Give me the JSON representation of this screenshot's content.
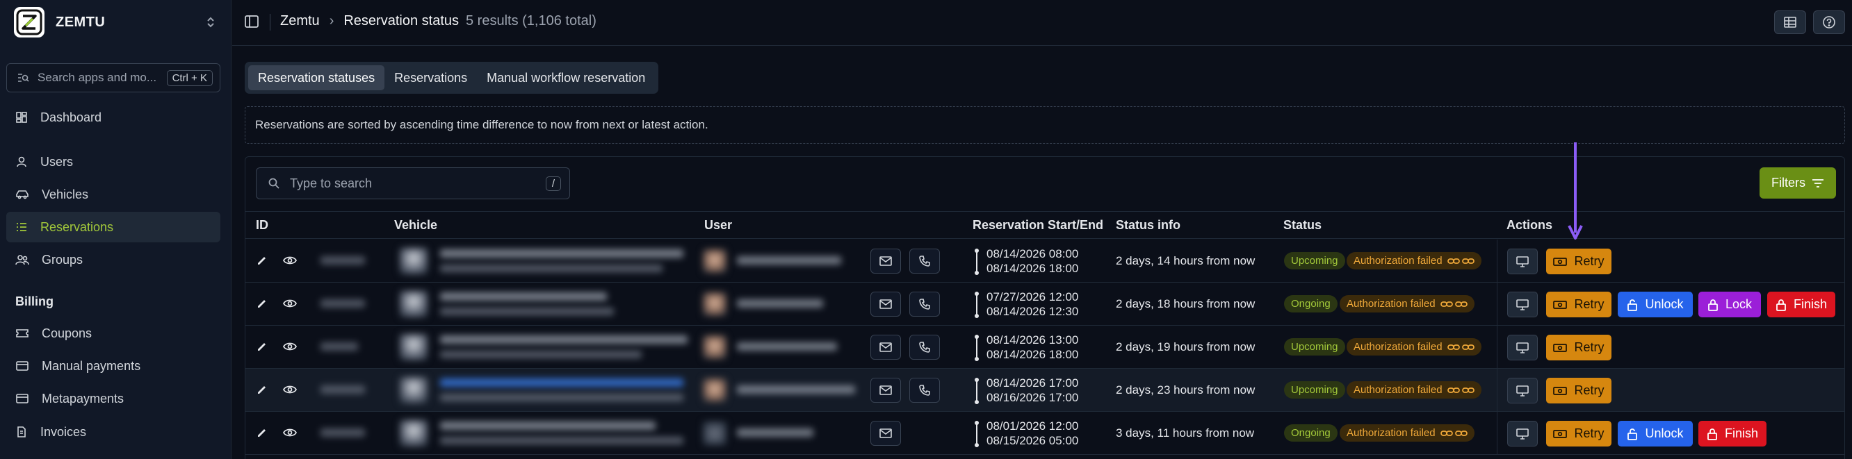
{
  "app": {
    "name": "ZEMTU"
  },
  "sidebar": {
    "search_placeholder": "Search apps and mo...",
    "search_shortcut": "Ctrl + K",
    "items": [
      {
        "label": "Dashboard",
        "icon": "dashboard-icon"
      },
      {
        "label": "Users",
        "icon": "user-icon"
      },
      {
        "label": "Vehicles",
        "icon": "car-icon"
      },
      {
        "label": "Reservations",
        "icon": "list-icon",
        "active": true
      },
      {
        "label": "Groups",
        "icon": "users-icon"
      }
    ],
    "billing_heading": "Billing",
    "billing_items": [
      {
        "label": "Coupons",
        "icon": "ticket-icon"
      },
      {
        "label": "Manual payments",
        "icon": "wallet-icon"
      },
      {
        "label": "Metapayments",
        "icon": "wallet-icon"
      },
      {
        "label": "Invoices",
        "icon": "document-icon"
      }
    ]
  },
  "header": {
    "breadcrumb_root": "Zemtu",
    "breadcrumb_current": "Reservation status",
    "results_count": "5 results (1,106 total)"
  },
  "tabs": [
    {
      "label": "Reservation statuses",
      "active": true
    },
    {
      "label": "Reservations"
    },
    {
      "label": "Manual workflow reservation"
    }
  ],
  "info_text": "Reservations are sorted by ascending time difference to now from next or latest action.",
  "table": {
    "search_placeholder": "Type to search",
    "search_shortcut": "/",
    "filters_label": "Filters",
    "columns": {
      "id": "ID",
      "vehicle": "Vehicle",
      "user": "User",
      "start_end": "Reservation Start/End",
      "status_info": "Status info",
      "status": "Status",
      "actions": "Actions"
    },
    "rows": [
      {
        "start": "08/14/2026 08:00",
        "end": "08/14/2026 18:00",
        "status_info": "2 days, 14 hours from now",
        "status": "Upcoming",
        "auth": "Authorization failed",
        "actions": [
          "Retry"
        ]
      },
      {
        "start": "07/27/2026 12:00",
        "end": "08/14/2026 12:30",
        "status_info": "2 days, 18 hours from now",
        "status": "Ongoing",
        "auth": "Authorization failed",
        "actions": [
          "Retry",
          "Unlock",
          "Lock",
          "Finish"
        ]
      },
      {
        "start": "08/14/2026 13:00",
        "end": "08/14/2026 18:00",
        "status_info": "2 days, 19 hours from now",
        "status": "Upcoming",
        "auth": "Authorization failed",
        "actions": [
          "Retry"
        ]
      },
      {
        "start": "08/14/2026 17:00",
        "end": "08/16/2026 17:00",
        "status_info": "2 days, 23 hours from now",
        "status": "Upcoming",
        "auth": "Authorization failed",
        "actions": [
          "Retry"
        ]
      },
      {
        "start": "08/01/2026 12:00",
        "end": "08/15/2026 05:00",
        "status_info": "3 days, 11 hours from now",
        "status": "Ongoing",
        "auth": "Authorization failed",
        "actions": [
          "Retry",
          "Unlock",
          "Finish"
        ]
      }
    ]
  },
  "colors": {
    "accent": "#a3c93a",
    "filters": "#6a8f15",
    "retry": "#d6870f",
    "unlock": "#2563eb",
    "lock": "#9b1fd8",
    "finish": "#dc1420",
    "annotation_arrow": "#8b5cf6"
  }
}
